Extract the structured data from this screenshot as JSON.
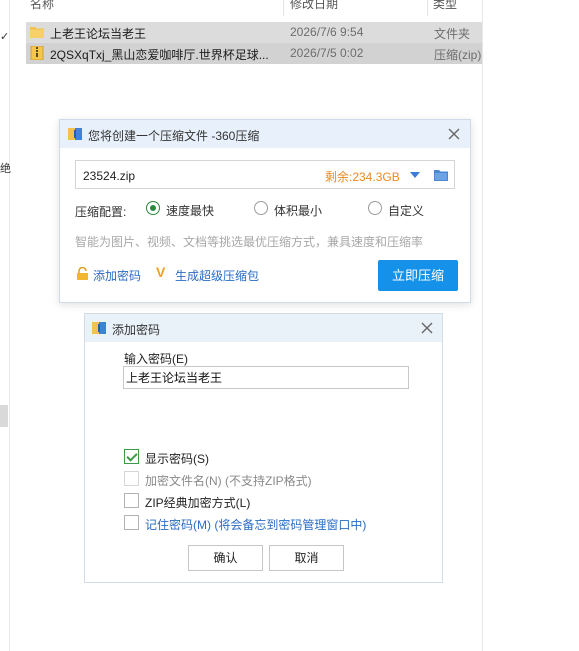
{
  "explorer": {
    "columns": {
      "name": "名称",
      "date": "修改日期",
      "type": "类型"
    },
    "files": [
      {
        "name": "上老王论坛当老王",
        "date": "2026/7/6 9:54",
        "type": "文件夹",
        "icon": "folder-icon"
      },
      {
        "name": "2QSXqTxj_黑山恋爱咖啡厅.世界杯足球...",
        "date": "2026/7/5 0:02",
        "type": "压缩(zip)",
        "icon": "zip-file-icon"
      }
    ],
    "left_marks": [
      "✓",
      "绝"
    ]
  },
  "compress_dialog": {
    "title": "您将创建一个压缩文件 -360压缩",
    "filename": "23524.zip",
    "free_space": "剩余:234.3GB",
    "config_label": "压缩配置:",
    "options": [
      {
        "label": "速度最快",
        "selected": true
      },
      {
        "label": "体积最小",
        "selected": false
      },
      {
        "label": "自定义",
        "selected": false
      }
    ],
    "hint": "智能为图片、视频、文档等挑选最优压缩方式，兼具速度和压缩率",
    "add_password": "添加密码",
    "super_package": "生成超级压缩包",
    "compress_button": "立即压缩",
    "colors": {
      "accent": "#1591ea",
      "free_space": "#ee8a1f",
      "link": "#2a6cc4",
      "radio": "#2a8a3c"
    }
  },
  "password_dialog": {
    "title": "添加密码",
    "input_label": "输入密码(E)",
    "password_value": "上老王论坛当老王",
    "options": [
      {
        "label": "显示密码(S)",
        "note": "",
        "checked": true,
        "disabled": false
      },
      {
        "label": "加密文件名(N)",
        "note": " (不支持ZIP格式)",
        "checked": false,
        "disabled": true
      },
      {
        "label": "ZIP经典加密方式(L)",
        "note": "",
        "checked": false,
        "disabled": false
      },
      {
        "label": "记住密码(M)",
        "note": " (将会备忘到密码管理窗口中)",
        "checked": false,
        "disabled": false
      }
    ],
    "ok_button": "确认",
    "cancel_button": "取消"
  }
}
